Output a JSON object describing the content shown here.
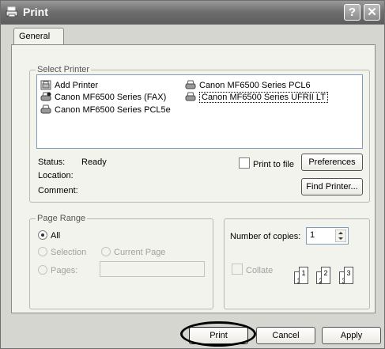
{
  "window": {
    "title": "Print",
    "help_label": "?",
    "close_label": "✕"
  },
  "tabs": [
    {
      "label": "General"
    }
  ],
  "select_printer": {
    "legend": "Select Printer",
    "printers": [
      {
        "name": "Add Printer",
        "icon": "add-printer-icon"
      },
      {
        "name": "Canon MF6500 Series PCL6",
        "icon": "printer-icon"
      },
      {
        "name": "Canon MF6500 Series (FAX)",
        "icon": "default-printer-icon"
      },
      {
        "name": "Canon MF6500 Series UFRII LT",
        "icon": "printer-icon",
        "selected": true
      },
      {
        "name": "Canon MF6500 Series PCL5e",
        "icon": "printer-icon"
      }
    ],
    "status_label": "Status:",
    "status_value": "Ready",
    "location_label": "Location:",
    "comment_label": "Comment:",
    "print_to_file_label": "Print to file",
    "print_to_file_checked": false,
    "preferences_label": "Preferences",
    "find_printer_label": "Find Printer..."
  },
  "page_range": {
    "legend": "Page Range",
    "all_label": "All",
    "selection_label": "Selection",
    "current_page_label": "Current Page",
    "pages_label": "Pages:",
    "pages_value": "",
    "selected": "All"
  },
  "copies": {
    "number_label": "Number of copies:",
    "number_value": "1",
    "collate_label": "Collate",
    "collate_checked": false,
    "collate_pages": [
      "1",
      "1",
      "2",
      "2",
      "3",
      "3"
    ]
  },
  "footer": {
    "print_label": "Print",
    "cancel_label": "Cancel",
    "apply_label": "Apply"
  }
}
